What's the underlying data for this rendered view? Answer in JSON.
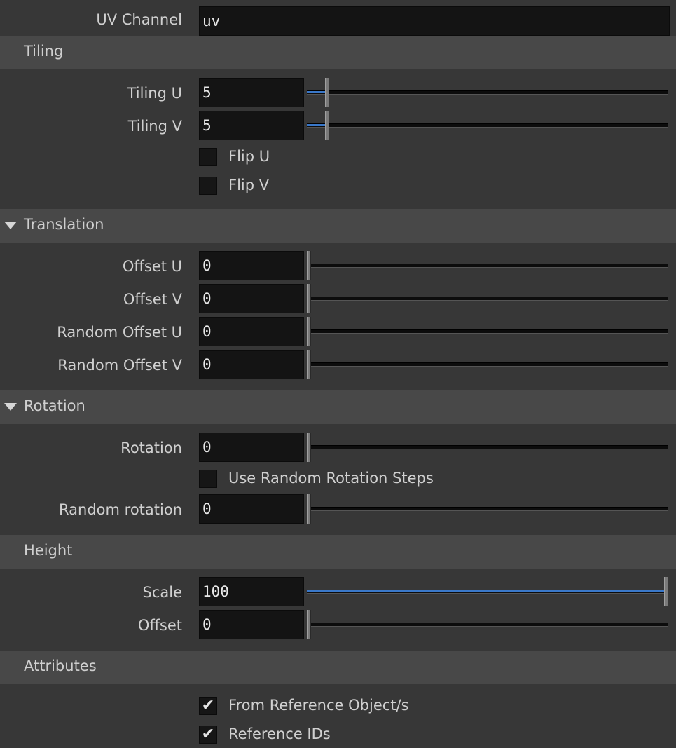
{
  "uv_channel": {
    "label": "UV Channel",
    "value": "uv"
  },
  "tiling": {
    "title": "Tiling",
    "tiling_u": {
      "label": "Tiling U",
      "value": "5",
      "slider_fraction": 0.05
    },
    "tiling_v": {
      "label": "Tiling V",
      "value": "5",
      "slider_fraction": 0.05
    },
    "flip_u": {
      "label": "Flip U",
      "checked": false
    },
    "flip_v": {
      "label": "Flip V",
      "checked": false
    }
  },
  "translation": {
    "title": "Translation",
    "offset_u": {
      "label": "Offset U",
      "value": "0",
      "slider_fraction": 0
    },
    "offset_v": {
      "label": "Offset V",
      "value": "0",
      "slider_fraction": 0
    },
    "random_offset_u": {
      "label": "Random Offset U",
      "value": "0",
      "slider_fraction": 0
    },
    "random_offset_v": {
      "label": "Random Offset V",
      "value": "0",
      "slider_fraction": 0
    }
  },
  "rotation": {
    "title": "Rotation",
    "rotation": {
      "label": "Rotation",
      "value": "0",
      "slider_fraction": 0
    },
    "use_random_steps": {
      "label": "Use Random Rotation Steps",
      "checked": false
    },
    "random_rotation": {
      "label": "Random rotation",
      "value": "0",
      "slider_fraction": 0
    }
  },
  "height": {
    "title": "Height",
    "scale": {
      "label": "Scale",
      "value": "100",
      "slider_fraction": 1.0
    },
    "offset": {
      "label": "Offset",
      "value": "0",
      "slider_fraction": 0
    }
  },
  "attributes": {
    "title": "Attributes",
    "from_reference": {
      "label": "From Reference Object/s",
      "checked": true
    },
    "reference_ids": {
      "label": "Reference IDs",
      "checked": true
    }
  },
  "icons": {
    "check": "✔",
    "expanded": "triangle-down-icon"
  },
  "colors": {
    "accent": "#3a78c9",
    "panel": "#373737",
    "header": "#484848",
    "field": "#141414"
  }
}
